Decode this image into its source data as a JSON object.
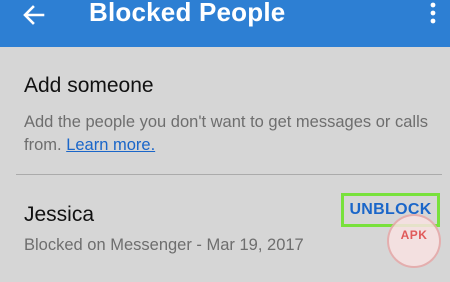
{
  "app_bar": {
    "title": "Blocked People",
    "back_icon": "arrow-left-icon",
    "menu_icon": "more-vertical-icon",
    "background_color": "#2d7fd3"
  },
  "add_section": {
    "title": "Add someone",
    "description": "Add the people you don't want to get messages or calls from.",
    "learn_more_label": "Learn more."
  },
  "blocked_list": [
    {
      "name": "Jessica",
      "status": "Blocked on Messenger - Mar 19, 2017",
      "action_label": "UNBLOCK"
    }
  ],
  "watermark": {
    "text": "APK"
  },
  "colors": {
    "accent": "#1a66c9",
    "highlight": "#78e13c",
    "background": "#d6d6d6"
  }
}
